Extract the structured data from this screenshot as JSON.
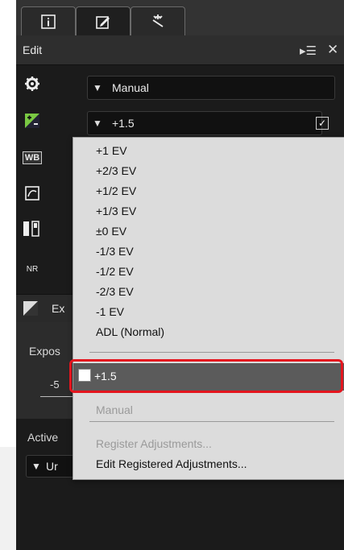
{
  "tabs": [
    {
      "icon": "info-icon"
    },
    {
      "icon": "edit-icon"
    },
    {
      "icon": "wand-icon"
    }
  ],
  "header": {
    "title": "Edit",
    "panel_menu_icon": "panel-menu-icon",
    "close_icon": "close-icon"
  },
  "left_icons": [
    "gear-icon",
    "exposure-icon",
    "white-balance-icon",
    "picture-control-icon",
    "levels-icon",
    "noise-reduction-icon"
  ],
  "dropdowns": {
    "picture_control": {
      "value": "Manual"
    },
    "exposure": {
      "value": "+1.5"
    }
  },
  "section": {
    "label": "Ex"
  },
  "exposure_panel": {
    "label": "Expos",
    "slider_min": "-5"
  },
  "active": {
    "label": "Active",
    "value": "Ur"
  },
  "menu": {
    "items": [
      "+1 EV",
      "+2/3 EV",
      "+1/2 EV",
      "+1/3 EV",
      "±0 EV",
      "-1/3 EV",
      "-1/2 EV",
      "-2/3 EV",
      "-1 EV",
      "ADL (Normal)"
    ],
    "selected": "+1.5",
    "manual": "Manual",
    "register": "Register Adjustments...",
    "edit_registered": "Edit Registered Adjustments..."
  },
  "colors": {
    "panel_bg": "#1b1b1b",
    "menu_bg": "#dcdcdc",
    "highlight": "#5b5b5b",
    "callout": "#e4151e"
  }
}
